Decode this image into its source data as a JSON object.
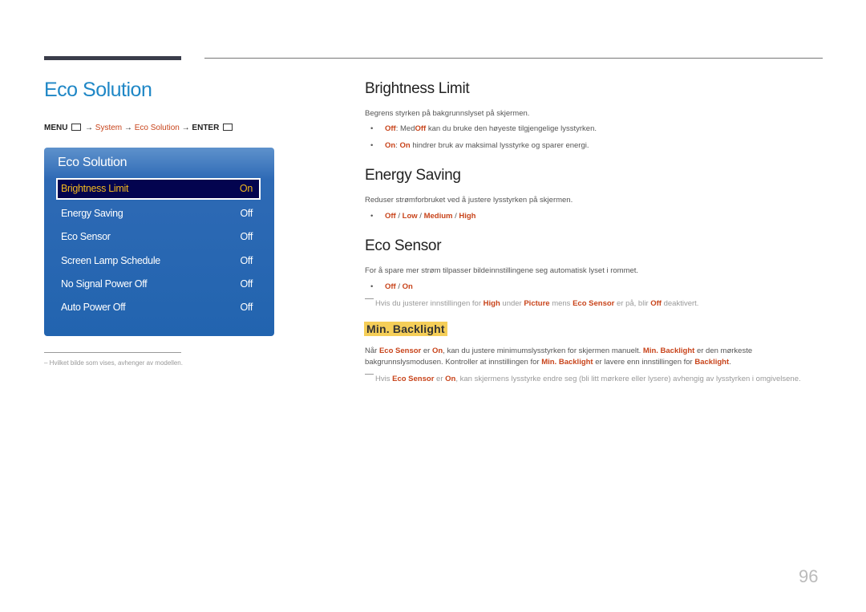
{
  "page": {
    "title": "Eco Solution",
    "page_number": "96"
  },
  "breadcrumb": {
    "menu": "MENU",
    "arrow": "→",
    "system": "System",
    "eco_solution": "Eco Solution",
    "enter": "ENTER"
  },
  "panel": {
    "title": "Eco Solution",
    "items": [
      {
        "label": "Brightness Limit",
        "value": "On",
        "selected": true
      },
      {
        "label": "Energy Saving",
        "value": "Off"
      },
      {
        "label": "Eco Sensor",
        "value": "Off"
      },
      {
        "label": "Screen Lamp Schedule",
        "value": "Off"
      },
      {
        "label": "No Signal Power Off",
        "value": "Off"
      },
      {
        "label": "Auto Power Off",
        "value": "Off"
      }
    ]
  },
  "footnote": "Hvilket bilde som vises, avhenger av modellen.",
  "sections": {
    "brightness_limit": {
      "heading": "Brightness Limit",
      "description": "Begrens styrken på bakgrunnslyset på skjermen.",
      "bullet1": {
        "key": "Off",
        "sep": ": Med",
        "key2": "Off",
        "text": " kan du bruke den høyeste tilgjengelige lysstyrken."
      },
      "bullet2": {
        "key": "On",
        "sep": ": ",
        "key2": "On",
        "text": " hindrer bruk av maksimal lysstyrke og sparer energi."
      }
    },
    "energy_saving": {
      "heading": "Energy Saving",
      "description": "Reduser strømforbruket ved å justere lysstyrken på skjermen.",
      "options": [
        "Off",
        "Low",
        "Medium",
        "High"
      ],
      "sep": " / "
    },
    "eco_sensor": {
      "heading": "Eco Sensor",
      "description": "For å spare mer strøm tilpasser bildeinnstillingene seg automatisk lyset i rommet.",
      "options": [
        "Off",
        "On"
      ],
      "sep": " / ",
      "note": {
        "t1": "Hvis du justerer innstillingen for ",
        "b1": "High",
        "t2": " under ",
        "b2": "Picture",
        "t3": " mens ",
        "b3": "Eco Sensor",
        "t4": " er på, blir ",
        "b4": "Off",
        "t5": " deaktivert."
      }
    },
    "min_backlight": {
      "heading": "Min. Backlight",
      "line1": {
        "t1": "Når ",
        "b1": "Eco Sensor",
        "t2": " er ",
        "b2": "On",
        "t3": ", kan du justere minimumslysstyrken for skjermen manuelt. ",
        "b3": "Min. Backlight",
        "t4": " er den mørkeste"
      },
      "line2": {
        "t1": "bakgrunnslysmodusen. Kontroller at innstillingen for ",
        "b1": "Min. Backlight",
        "t2": " er lavere enn innstillingen for ",
        "b2": "Backlight",
        "t3": "."
      },
      "note": {
        "t1": "Hvis ",
        "b1": "Eco Sensor",
        "t2": " er ",
        "b2": "On",
        "t3": ", kan skjermens lysstyrke endre seg (bli litt mørkere eller lysere) avhengig av lysstyrken i omgivelsene."
      }
    }
  }
}
